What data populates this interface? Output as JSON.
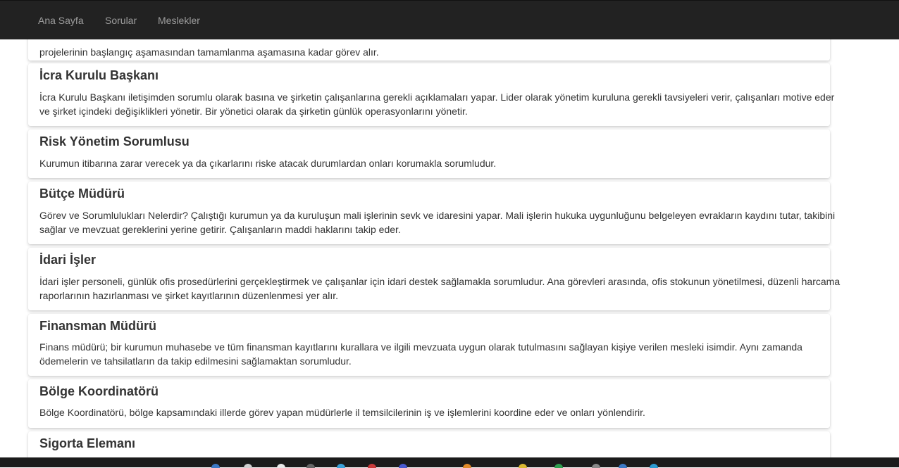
{
  "nav": {
    "home": "Ana Sayfa",
    "questions": "Sorular",
    "professions": "Meslekler"
  },
  "cards": [
    {
      "title": "",
      "lines": [
        "projelerinin başlangıç aşamasından tamamlanma aşamasına kadar görev alır."
      ]
    },
    {
      "title": "İcra Kurulu Başkanı",
      "lines": [
        "İcra Kurulu Başkanı iletişimden sorumlu olarak basına ve şirketin çalışanlarına gerekli açıklamaları yapar. Lider olarak yönetim kuruluna gerekli tavsiyeleri verir, çalışanları motive eder",
        "ve şirket içindeki değişiklikleri yönetir. Bir yönetici olarak da şirketin günlük operasyonlarını yönetir."
      ]
    },
    {
      "title": "Risk Yönetim Sorumlusu",
      "lines": [
        "Kurumun itibarına zarar verecek ya da çıkarlarını riske atacak durumlardan onları korumakla sorumludur."
      ]
    },
    {
      "title": "Bütçe Müdürü",
      "lines": [
        "Görev ve Sorumlulukları Nelerdir? Çalıştığı kurumun ya da kuruluşun mali işlerinin sevk ve idaresini yapar. Mali işlerin hukuka uygunluğunu belgeleyen evrakların kaydını tutar, takibini",
        "sağlar ve mevzuat gereklerini yerine getirir. Çalışanların maddi haklarını takip eder."
      ]
    },
    {
      "title": "İdari İşler",
      "lines": [
        "İdari işler personeli, günlük ofis prosedürlerini gerçekleştirmek ve çalışanlar için idari destek sağlamakla sorumludur. Ana görevleri arasında, ofis stokunun yönetilmesi, düzenli harcama",
        "raporlarının hazırlanması ve şirket kayıtlarının düzenlenmesi yer alır."
      ]
    },
    {
      "title": "Finansman Müdürü",
      "lines": [
        "Finans müdürü; bir kurumun muhasebe ve tüm finansman kayıtlarını kurallara ve ilgili mevzuata uygun olarak tutulmasını sağlayan kişiye verilen mesleki isimdir. Aynı zamanda",
        "ödemelerin ve tahsilatların da takip edilmesini sağlamaktan sorumludur."
      ]
    },
    {
      "title": "Bölge Koordinatörü",
      "lines": [
        "Bölge Koordinatörü, bölge kapsamındaki illerde görev yapan müdürlerle il temsilcilerinin iş ve işlemlerini koordine eder ve onları yönlendirir."
      ]
    },
    {
      "title": "Sigorta Elemanı",
      "lines": []
    }
  ],
  "colors": {
    "navbar_bg": "#222222",
    "nav_link": "#9d9d9d",
    "text": "#333333"
  }
}
